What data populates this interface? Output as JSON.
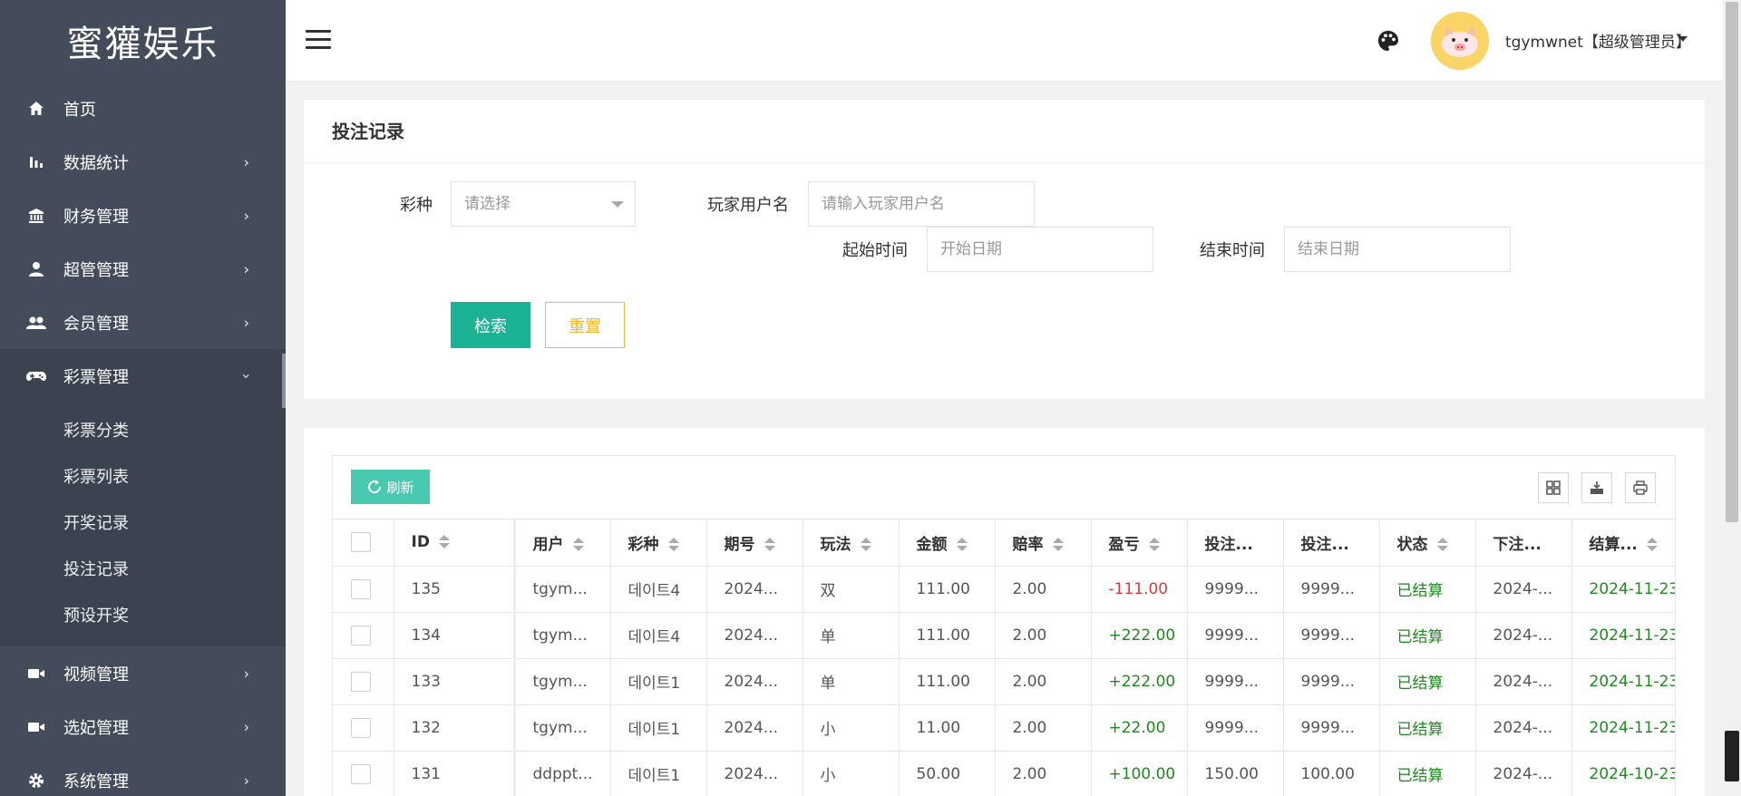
{
  "brand": "蜜獾娱乐",
  "sidebar": {
    "items": [
      {
        "label": "首页",
        "icon": "home-icon"
      },
      {
        "label": "数据统计",
        "icon": "bar-chart-icon"
      },
      {
        "label": "财务管理",
        "icon": "bank-icon"
      },
      {
        "label": "超管管理",
        "icon": "user-icon"
      },
      {
        "label": "会员管理",
        "icon": "users-icon"
      },
      {
        "label": "彩票管理",
        "icon": "gamepad-icon"
      },
      {
        "label": "视频管理",
        "icon": "video-icon"
      },
      {
        "label": "选妃管理",
        "icon": "video-icon"
      },
      {
        "label": "系统管理",
        "icon": "gear-icon"
      }
    ],
    "submenu": [
      "彩票分类",
      "彩票列表",
      "开奖记录",
      "投注记录",
      "预设开奖"
    ]
  },
  "header": {
    "user": "tgymwnet【超级管理员】"
  },
  "search": {
    "title": "投注记录",
    "lottery_label": "彩种",
    "lottery_placeholder": "请选择",
    "username_label": "玩家用户名",
    "username_placeholder": "请输入玩家用户名",
    "start_label": "起始时间",
    "start_placeholder": "开始日期",
    "end_label": "结束时间",
    "end_placeholder": "结束日期",
    "search_btn": "检索",
    "reset_btn": "重置"
  },
  "table": {
    "refresh_btn": "刷新",
    "columns": [
      "ID",
      "用户",
      "彩种",
      "期号",
      "玩法",
      "金额",
      "赔率",
      "盈亏",
      "投注...",
      "投注...",
      "状态",
      "下注...",
      "结算..."
    ],
    "rows": [
      {
        "id": "135",
        "user": "tgym...",
        "lottery": "데이트4",
        "issue": "2024...",
        "play": "双",
        "amount": "111.00",
        "odds": "2.00",
        "profit": "-111.00",
        "bet1": "9999...",
        "bet2": "9999...",
        "status": "已结算",
        "bet_time": "2024-...",
        "settle_time": "2024-11-23"
      },
      {
        "id": "134",
        "user": "tgym...",
        "lottery": "데이트4",
        "issue": "2024...",
        "play": "单",
        "amount": "111.00",
        "odds": "2.00",
        "profit": "+222.00",
        "bet1": "9999...",
        "bet2": "9999...",
        "status": "已结算",
        "bet_time": "2024-...",
        "settle_time": "2024-11-23"
      },
      {
        "id": "133",
        "user": "tgym...",
        "lottery": "데이트1",
        "issue": "2024...",
        "play": "单",
        "amount": "111.00",
        "odds": "2.00",
        "profit": "+222.00",
        "bet1": "9999...",
        "bet2": "9999...",
        "status": "已结算",
        "bet_time": "2024-...",
        "settle_time": "2024-11-23"
      },
      {
        "id": "132",
        "user": "tgym...",
        "lottery": "데이트1",
        "issue": "2024...",
        "play": "小",
        "amount": "11.00",
        "odds": "2.00",
        "profit": "+22.00",
        "bet1": "9999...",
        "bet2": "9999...",
        "status": "已结算",
        "bet_time": "2024-...",
        "settle_time": "2024-11-23"
      },
      {
        "id": "131",
        "user": "ddppt...",
        "lottery": "데이트1",
        "issue": "2024...",
        "play": "小",
        "amount": "50.00",
        "odds": "2.00",
        "profit": "+100.00",
        "bet1": "150.00",
        "bet2": "100.00",
        "status": "已结算",
        "bet_time": "2024-...",
        "settle_time": "2024-10-23"
      }
    ]
  },
  "colors": {
    "sidebar": "#444c5b",
    "primary": "#1ab394",
    "warning": "#f7b53b",
    "loss": "#e4393c",
    "gain": "#1e8a1e"
  }
}
